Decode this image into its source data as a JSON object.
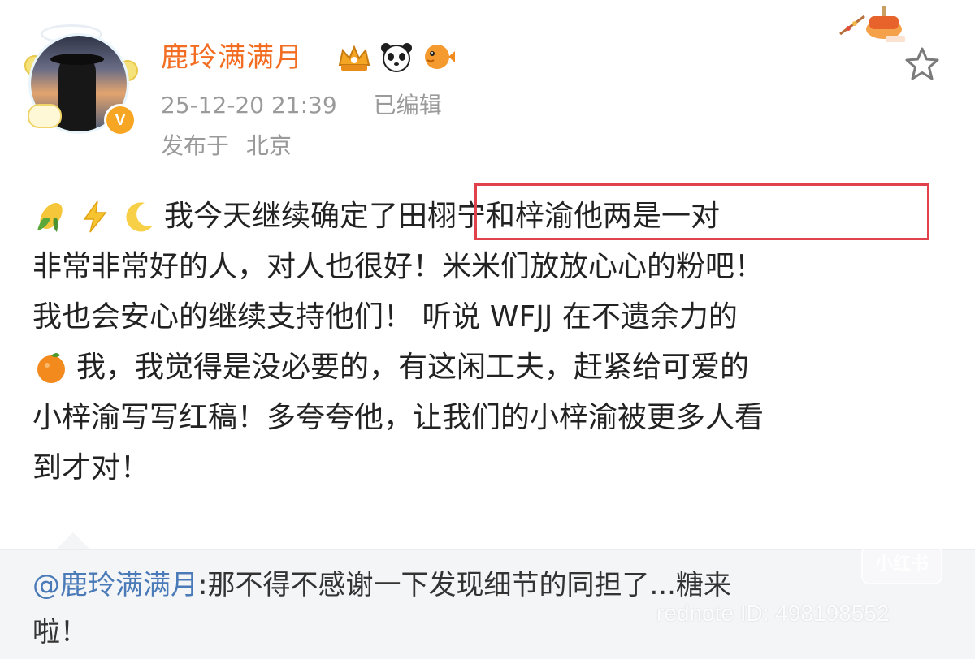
{
  "post": {
    "username": "鹿玲满满月",
    "timestamp": "25-12-20 21:39",
    "edited_label": "已编辑",
    "location_prefix": "发布于",
    "location": "北京",
    "badges": [
      "crown-badge",
      "panda-badge",
      "pufferfish-badge"
    ],
    "verified_mark": "V",
    "body_lines": [
      "我今天继续确定了田栩宁和梓渝他两是一对",
      "非常非常好的人，对人也很好！米米们放放心心的粉吧！",
      "我也会安心的继续支持他们！  听说 WFJJ 在不遗余力的",
      "我，我觉得是没必要的，有这闲工夫，赶紧给可爱的",
      "小梓渝写写红稿！多夸夸他，让我们的小梓渝被更多人看",
      "到才对！"
    ],
    "leading_emojis": [
      "corn-emoji",
      "lightning-emoji",
      "crescent-moon-emoji"
    ],
    "inline_emoji_line4": "orange-emoji",
    "highlighted_phrase": "田栩宁和梓渝他两是一对"
  },
  "reply": {
    "mention": "@鹿玲满满月",
    "text_line1": ":那不得不感谢一下发现细节的同担了...糖来",
    "text_line2": "啦！"
  },
  "watermark": {
    "logo_text": "小红书",
    "id_text": "rednote ID: 498198552"
  },
  "colors": {
    "username": "#f26d22",
    "meta": "#9a9a9a",
    "body_text": "#222222",
    "highlight_border": "#e0424c",
    "mention": "#4a7ab8",
    "reply_bg": "#f4f5f7",
    "verified": "#f7a623"
  }
}
